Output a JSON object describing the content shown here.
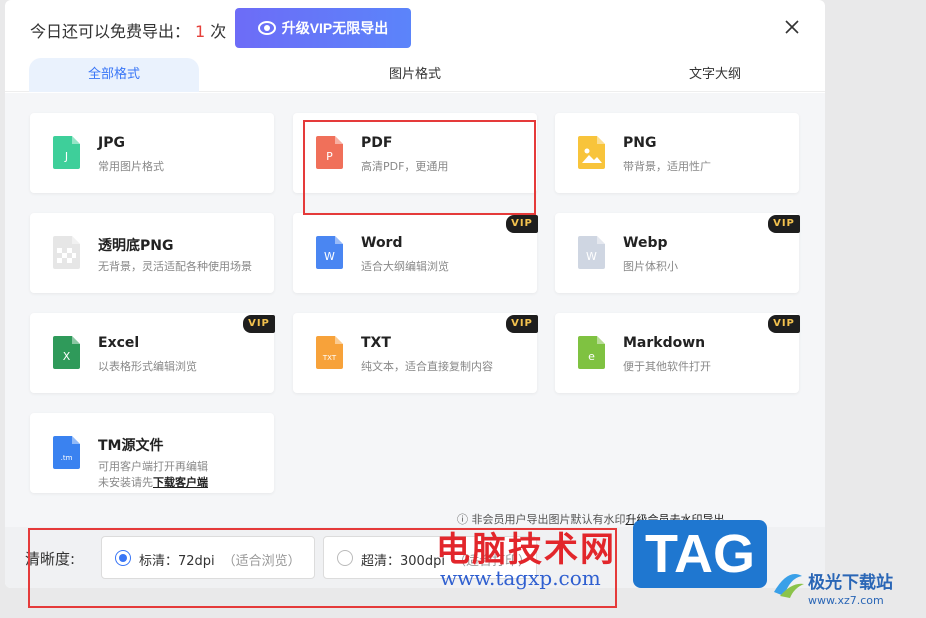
{
  "header": {
    "quota_prefix": "今日还可以免费导出：",
    "quota_count": "1",
    "quota_suffix": "次",
    "vip_button_label": "升级VIP无限导出"
  },
  "tabs": [
    {
      "label": "全部格式",
      "active": true
    },
    {
      "label": "图片格式",
      "active": false
    },
    {
      "label": "文字大纲",
      "active": false
    }
  ],
  "formats": [
    {
      "name": "JPG",
      "desc": "常用图片格式",
      "vip": false,
      "icon": "jpg-file-icon",
      "color": "#3ecf9a",
      "letter": "J"
    },
    {
      "name": "PDF",
      "desc": "高清PDF，更通用",
      "vip": false,
      "icon": "pdf-file-icon",
      "color": "#f0705a",
      "letter": "P"
    },
    {
      "name": "PNG",
      "desc": "带背景，适用性广",
      "vip": false,
      "icon": "png-file-icon",
      "color": "#f8c43b",
      "letter": ""
    },
    {
      "name": "透明底PNG",
      "desc": "无背景，灵活适配各种使用场景",
      "vip": false,
      "icon": "transparent-png-file-icon",
      "color": "#e6e6e6",
      "letter": ""
    },
    {
      "name": "Word",
      "desc": "适合大纲编辑浏览",
      "vip": true,
      "icon": "word-file-icon",
      "color": "#4a86f2",
      "letter": "W"
    },
    {
      "name": "Webp",
      "desc": "图片体积小",
      "vip": true,
      "icon": "webp-file-icon",
      "color": "#cfd6e2",
      "letter": "W"
    },
    {
      "name": "Excel",
      "desc": "以表格形式编辑浏览",
      "vip": true,
      "icon": "excel-file-icon",
      "color": "#2f9a5a",
      "letter": "X"
    },
    {
      "name": "TXT",
      "desc": "纯文本，适合直接复制内容",
      "vip": true,
      "icon": "txt-file-icon",
      "color": "#f7a23a",
      "letter": "TXT"
    },
    {
      "name": "Markdown",
      "desc": "便于其他软件打开",
      "vip": true,
      "icon": "markdown-file-icon",
      "color": "#7fc241",
      "letter": "e"
    },
    {
      "name": "TM源文件",
      "desc": "可用客户端打开再编辑",
      "desc2": "未安装请先",
      "desc2_link": "下载客户端",
      "vip": false,
      "icon": "tm-file-icon",
      "color": "#3a82f0",
      "letter": ".tm"
    }
  ],
  "vip_badge": "VIP",
  "note": {
    "text": "非会员用户导出图片默认有水印",
    "link": "升级会员去水印导出"
  },
  "footer": {
    "label": "清晰度:",
    "options": [
      {
        "label": "标清：72dpi",
        "hint": "（适合浏览）",
        "selected": true
      },
      {
        "label": "超清：300dpi",
        "hint": "（适合打印）",
        "selected": false
      }
    ]
  },
  "watermark": {
    "cn_text": "电脑技术网",
    "url": "www.tagxp.com",
    "tag": "TAG",
    "site_name": "极光下载站",
    "site_url": "www.xz7.com"
  }
}
